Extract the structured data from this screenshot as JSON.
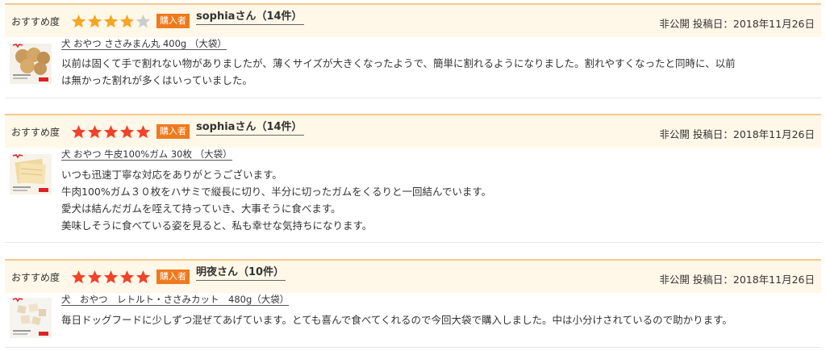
{
  "labels": {
    "recommend": "おすすめ度",
    "buyer_badge": "購入者",
    "private": "非公開",
    "posted_prefix": "投稿日："
  },
  "colors": {
    "star_filled": "#f0432a",
    "star_partial": "#f5a623",
    "star_empty": "#cccccc",
    "badge": "#ef7a1d",
    "header_bg": "#fff7e8",
    "header_border": "#f6c98b"
  },
  "reviews": [
    {
      "rating": 4,
      "reviewer": "sophiaさん（14件）",
      "privacy": "非公開",
      "date": "2018年11月26日",
      "product": "犬 おやつ ささみまん丸 400g （大袋）",
      "text_lines": [
        "以前は固くて手で割れない物がありましたが、薄くサイズが大きくなったようで、簡単に割れるようになりました。割れやすくなったと同時に、以前",
        "は無かった割れが多くはいっていました。"
      ]
    },
    {
      "rating": 5,
      "reviewer": "sophiaさん（14件）",
      "privacy": "非公開",
      "date": "2018年11月26日",
      "product": "犬 おやつ 牛皮100%ガム 30枚 （大袋）",
      "text_lines": [
        "いつも迅速丁寧な対応をありがとうございます。",
        "牛肉100%ガム３０枚をハサミで縦長に切り、半分に切ったガムをくるりと一回結んでいます。",
        "愛犬は結んだガムを咥えて持っていき、大事そうに食べます。",
        "美味しそうに食べている姿を見ると、私も幸せな気持ちになります。"
      ]
    },
    {
      "rating": 5,
      "reviewer": "明夜さん（10件）",
      "privacy": "非公開",
      "date": "2018年11月26日",
      "product": "犬　おやつ　レトルト・ささみカット　480g（大袋）",
      "text_lines": [
        "毎日ドッグフードに少しずつ混ぜてあげています。とても喜んで食べてくれるので今回大袋で購入しました。中は小分けされているので助かります。"
      ]
    }
  ]
}
